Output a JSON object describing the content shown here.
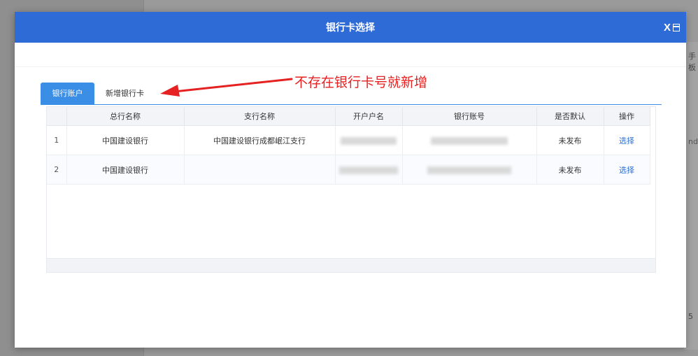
{
  "background": {
    "right_text_1": "手板",
    "right_text_2": "nd",
    "right_text_3": "5"
  },
  "modal": {
    "title": "银行卡选择",
    "close_label": "X"
  },
  "tabs": [
    {
      "label": "银行账户",
      "active": true
    },
    {
      "label": "新增银行卡",
      "active": false
    }
  ],
  "annotation": {
    "text": "不存在银行卡号就新增",
    "color": "#e52121"
  },
  "table": {
    "columns": [
      "",
      "总行名称",
      "支行名称",
      "开户户名",
      "银行账号",
      "是否默认",
      "操作"
    ],
    "rows": [
      {
        "index": "1",
        "bank": "中国建设银行",
        "branch": "中国建设银行成都岷江支行",
        "holder": "",
        "account": "",
        "default": "未发布",
        "action": "选择"
      },
      {
        "index": "2",
        "bank": "中国建设银行",
        "branch": "",
        "holder": "",
        "account": "",
        "default": "未发布",
        "action": "选择"
      }
    ]
  },
  "colors": {
    "header_bg": "#2f6bd6",
    "tab_active": "#3a8ee6",
    "link": "#2a6fd6"
  }
}
